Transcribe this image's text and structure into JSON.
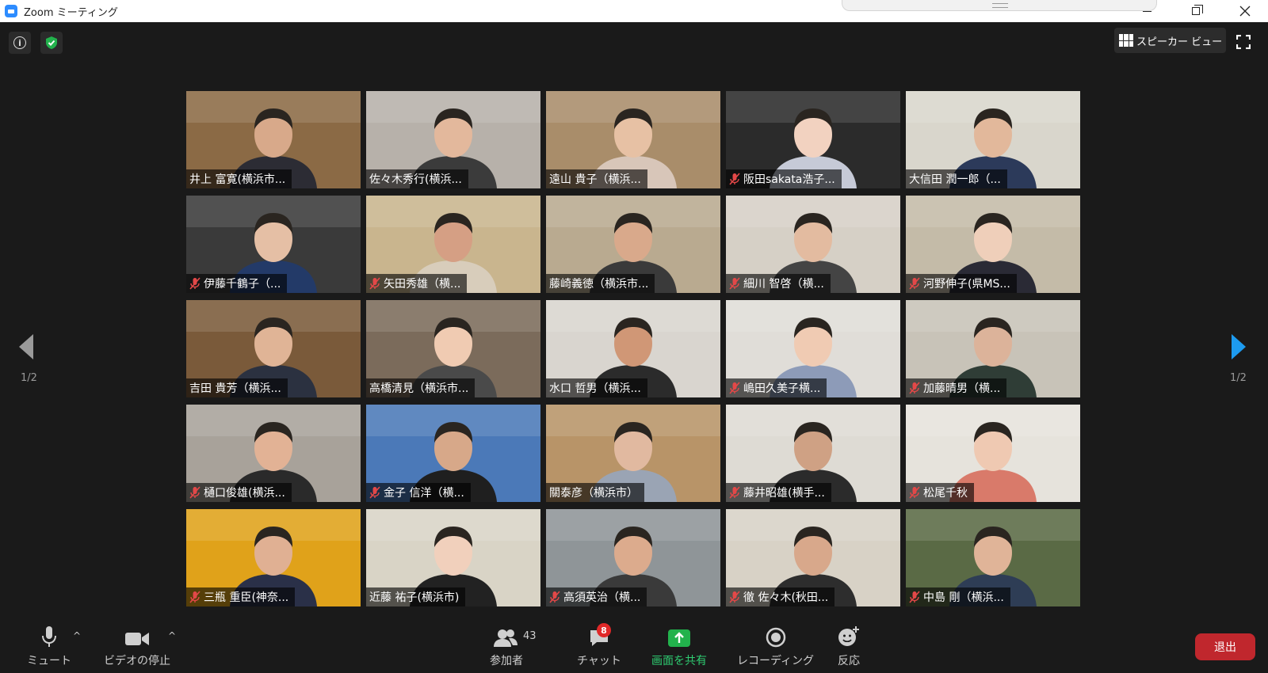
{
  "window": {
    "title": "Zoom ミーティング"
  },
  "top": {
    "view_label": "スピーカー ビュー"
  },
  "pagination": {
    "left": "1/2",
    "right": "1/2"
  },
  "participants": [
    {
      "name": "井上 富寛(横浜市...",
      "muted": false,
      "bg": "#8b6a45",
      "skin": "#d8a98a",
      "shirt": "#2c2c34"
    },
    {
      "name": "佐々木秀行(横浜...",
      "muted": false,
      "bg": "#b7b1aa",
      "skin": "#e3b89c",
      "shirt": "#3b3b3b"
    },
    {
      "name": "遠山 貴子（横浜...",
      "muted": false,
      "bg": "#a98d6a",
      "skin": "#e7c1a4",
      "shirt": "#d8c6b9"
    },
    {
      "name": "阪田sakata浩子...",
      "muted": true,
      "bg": "#2b2b2b",
      "skin": "#f2d2c0",
      "shirt": "#c6cad7"
    },
    {
      "name": "大信田 潤一郎（...",
      "muted": false,
      "bg": "#d9d6cc",
      "skin": "#e2b89b",
      "shirt": "#2c3a5a"
    },
    {
      "name": "伊藤千鶴子（...",
      "muted": true,
      "bg": "#3a3a3a",
      "skin": "#e5bfa5",
      "shirt": "#233a68"
    },
    {
      "name": "矢田秀雄（横...",
      "muted": true,
      "bg": "#c9b58e",
      "skin": "#d59f84",
      "shirt": "#d8cdbb"
    },
    {
      "name": "藤崎義徳（横浜市...",
      "muted": false,
      "bg": "#b9aa90",
      "skin": "#d9a98b",
      "shirt": "#3a3a3a"
    },
    {
      "name": "細川 智啓（横...",
      "muted": true,
      "bg": "#d6d0c6",
      "skin": "#e3bba0",
      "shirt": "#444444"
    },
    {
      "name": "河野伸子(県MS...",
      "muted": true,
      "bg": "#c4bba8",
      "skin": "#efcfba",
      "shirt": "#2a2a35"
    },
    {
      "name": "吉田 貴芳（横浜...",
      "muted": false,
      "bg": "#7a5a3a",
      "skin": "#e0b496",
      "shirt": "#2b3140"
    },
    {
      "name": "高橋清見（横浜市...",
      "muted": false,
      "bg": "#7b6b5b",
      "skin": "#f0cbb2",
      "shirt": "#4a4a4a"
    },
    {
      "name": "水口 哲男（横浜...",
      "muted": false,
      "bg": "#d9d5cf",
      "skin": "#d09776",
      "shirt": "#2b2b2b"
    },
    {
      "name": "嶋田久美子横...",
      "muted": true,
      "bg": "#e0ddd8",
      "skin": "#f0cbb3",
      "shirt": "#8d9bb8"
    },
    {
      "name": "加藤晴男（横...",
      "muted": true,
      "bg": "#c8c3b8",
      "skin": "#dcb39a",
      "shirt": "#2f3d36"
    },
    {
      "name": "樋口俊雄(横浜...",
      "muted": true,
      "bg": "#a8a29a",
      "skin": "#e2b295",
      "shirt": "#2a2a2a"
    },
    {
      "name": "金子 信洋（横...",
      "muted": true,
      "bg": "#4b79b8",
      "skin": "#d7a889",
      "shirt": "#1f1f1f"
    },
    {
      "name": "關泰彦（横浜市）",
      "muted": false,
      "bg": "#b89468",
      "skin": "#e1b9a0",
      "shirt": "#9aa4b4"
    },
    {
      "name": "藤井昭雄(横手...",
      "muted": true,
      "bg": "#dedbd4",
      "skin": "#cfa184",
      "shirt": "#2b2b2b"
    },
    {
      "name": "松尾千秋",
      "muted": true,
      "bg": "#e6e3dc",
      "skin": "#efc9b2",
      "shirt": "#d97a6a"
    },
    {
      "name": "三瓶 重臣(神奈...",
      "muted": true,
      "bg": "#e0a21a",
      "skin": "#e0b093",
      "shirt": "#2a3048"
    },
    {
      "name": "近藤 祐子(横浜市)",
      "muted": false,
      "bg": "#d9d4c6",
      "skin": "#f1d0bc",
      "shirt": "#222222"
    },
    {
      "name": "高須英治（横...",
      "muted": true,
      "bg": "#8f9598",
      "skin": "#dcab8d",
      "shirt": "#3a3a3a"
    },
    {
      "name": "徹 佐々木(秋田...",
      "muted": true,
      "bg": "#d8d2c6",
      "skin": "#d8a88b",
      "shirt": "#2d2d2d"
    },
    {
      "name": "中島 剛（横浜...",
      "muted": true,
      "bg": "#5a6a45",
      "skin": "#e0b498",
      "shirt": "#2e3d55"
    }
  ],
  "toolbar": {
    "mute": "ミュート",
    "video": "ビデオの停止",
    "participants": "参加者",
    "participants_count": "43",
    "chat": "チャット",
    "chat_badge": "8",
    "share": "画面を共有",
    "record": "レコーディング",
    "reactions": "反応",
    "leave": "退出"
  }
}
